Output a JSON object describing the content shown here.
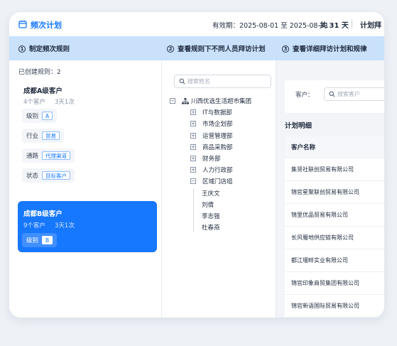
{
  "header": {
    "title": "频次计划",
    "validity": "有效期：2025-08-01 至 2025-08-31",
    "total_days": "共 31 天",
    "cut_label": "计划拜"
  },
  "steps": [
    {
      "num": "1",
      "label": "制定频次规则"
    },
    {
      "num": "2",
      "label": "查看规则下不同人员拜访计划"
    },
    {
      "num": "3",
      "label": "查看详细拜访计划和规律"
    }
  ],
  "rules": {
    "count_label": "已创建规则：2",
    "rule_a": {
      "title": "成都A级客户",
      "customers": "4个客户",
      "frequency": "3天1次",
      "conditions": [
        {
          "label": "级别",
          "tag": "A"
        },
        {
          "label": "行业",
          "tag": "贸易"
        },
        {
          "label": "通路",
          "tag": "代理渠道"
        },
        {
          "label": "状态",
          "tag": "目标客户"
        }
      ]
    },
    "rule_b": {
      "title": "成都B级客户",
      "customers": "9个客户",
      "frequency": "3天1次",
      "condition": {
        "label": "级别",
        "tag": "B"
      }
    }
  },
  "org_tree": {
    "search_placeholder": "搜索姓名",
    "root": "川西优选生活超市集团",
    "departments": [
      "IT与数据部",
      "市场企划部",
      "运营管理部",
      "商品采购部",
      "财务部",
      "人力行政部",
      "区域门店组"
    ],
    "people": [
      "王庆文",
      "刘倩",
      "李志强",
      "杜春燕"
    ]
  },
  "plan": {
    "customer_label": "客户：",
    "customer_placeholder": "搜索客户",
    "title": "计划明细",
    "column_header": "客户名称",
    "rows": [
      "集贤社联创贸易有限公司",
      "锦官星聚联创贸易有限公司",
      "锦里优品贸易有限公司",
      "长风蜀地供应链有限公司",
      "都江堰畔实业有限公司",
      "锦官印象商贸集团有限公司",
      "锦官新语国际贸易有限公司"
    ]
  },
  "colors": {
    "accent": "#1677ff",
    "step_bar": "#c9e1fb",
    "page_bg": "#eef1f6"
  }
}
